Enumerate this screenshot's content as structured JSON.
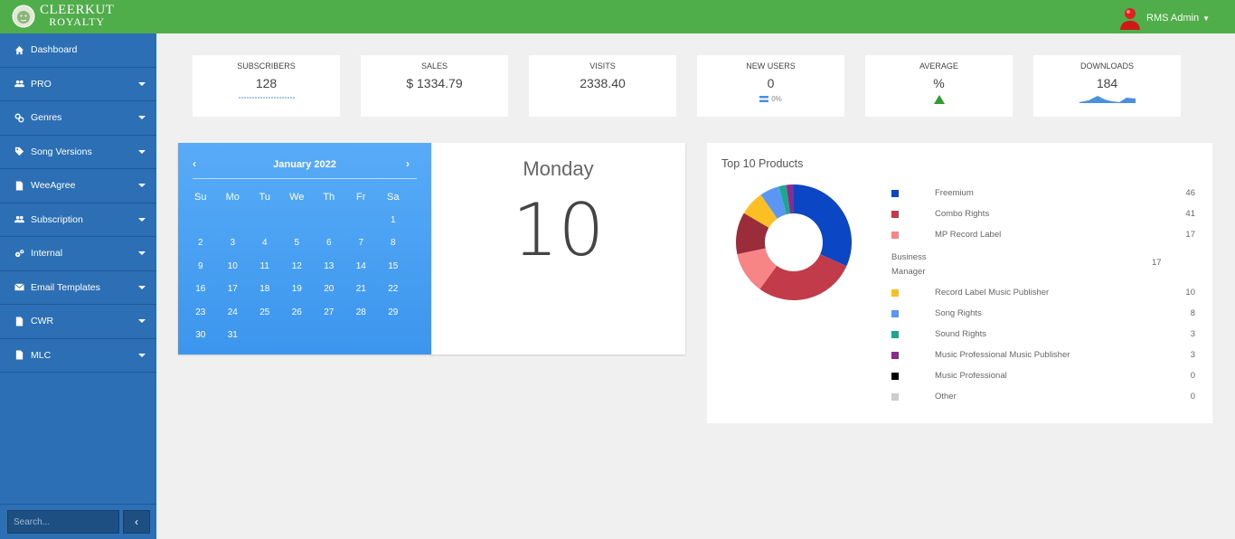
{
  "brand": {
    "name_line1": "CLEERKUT",
    "name_line2": "ROYALTY"
  },
  "user": {
    "name": "RMS Admin"
  },
  "sidebar": {
    "items": [
      {
        "label": "Dashboard",
        "icon": "home-icon",
        "has_dropdown": false
      },
      {
        "label": "PRO",
        "icon": "users-icon",
        "has_dropdown": true
      },
      {
        "label": "Genres",
        "icon": "link-icon",
        "has_dropdown": true
      },
      {
        "label": "Song Versions",
        "icon": "tags-icon",
        "has_dropdown": true
      },
      {
        "label": "WeeAgree",
        "icon": "file-icon",
        "has_dropdown": true
      },
      {
        "label": "Subscription",
        "icon": "users-icon",
        "has_dropdown": true
      },
      {
        "label": "Internal",
        "icon": "gears-icon",
        "has_dropdown": true
      },
      {
        "label": "Email Templates",
        "icon": "envelope-icon",
        "has_dropdown": true
      },
      {
        "label": "CWR",
        "icon": "file-icon",
        "has_dropdown": true
      },
      {
        "label": "MLC",
        "icon": "file-icon",
        "has_dropdown": true
      }
    ],
    "search_placeholder": "Search...",
    "collapse_label": "‹"
  },
  "stats": [
    {
      "title": "SUBSCRIBERS",
      "value": "128",
      "sub": ""
    },
    {
      "title": "SALES",
      "value": "$ 1334.79",
      "sub": ""
    },
    {
      "title": "VISITS",
      "value": "2338.40",
      "sub": ""
    },
    {
      "title": "NEW USERS",
      "value": "0",
      "sub": "0%"
    },
    {
      "title": "AVERAGE",
      "value": "%",
      "sub": ""
    },
    {
      "title": "DOWNLOADS",
      "value": "184",
      "sub": ""
    }
  ],
  "calendar": {
    "month_label": "January 2022",
    "prev": "‹",
    "next": "›",
    "weekdays": [
      "Su",
      "Mo",
      "Tu",
      "We",
      "Th",
      "Fr",
      "Sa"
    ],
    "weeks": [
      [
        "",
        "",
        "",
        "",
        "",
        "",
        "1"
      ],
      [
        "2",
        "3",
        "4",
        "5",
        "6",
        "7",
        "8"
      ],
      [
        "9",
        "10",
        "11",
        "12",
        "13",
        "14",
        "15"
      ],
      [
        "16",
        "17",
        "18",
        "19",
        "20",
        "21",
        "22"
      ],
      [
        "23",
        "24",
        "25",
        "26",
        "27",
        "28",
        "29"
      ],
      [
        "30",
        "31",
        "",
        "",
        "",
        "",
        ""
      ]
    ],
    "weekday_name": "Monday",
    "day_number": "10"
  },
  "top_products": {
    "title": "Top 10 Products",
    "items": [
      {
        "name": "Freemium",
        "value": 46,
        "color": "#0b47c4"
      },
      {
        "name": "Combo Rights",
        "value": 41,
        "color": "#c23b4b"
      },
      {
        "name": "MP Record Label",
        "value": 17,
        "color": "#f78585"
      },
      {
        "name": "Business Manager",
        "value": 17,
        "color": "#9b2c3a"
      },
      {
        "name": "Record Label Music Publisher",
        "value": 10,
        "color": "#fbbf24"
      },
      {
        "name": "Song Rights",
        "value": 8,
        "color": "#5b97f2"
      },
      {
        "name": "Sound Rights",
        "value": 3,
        "color": "#1ca88c"
      },
      {
        "name": "Music Professional Music Publisher",
        "value": 3,
        "color": "#8a2b8f"
      },
      {
        "name": "Music Professional",
        "value": 0,
        "color": "#000000"
      },
      {
        "name": "Other",
        "value": 0,
        "color": "#cccccc"
      }
    ]
  },
  "colors": {
    "topbar": "#4fae4a",
    "sidebar": "#2c6fb5",
    "calendar": "#4aa2f4"
  }
}
